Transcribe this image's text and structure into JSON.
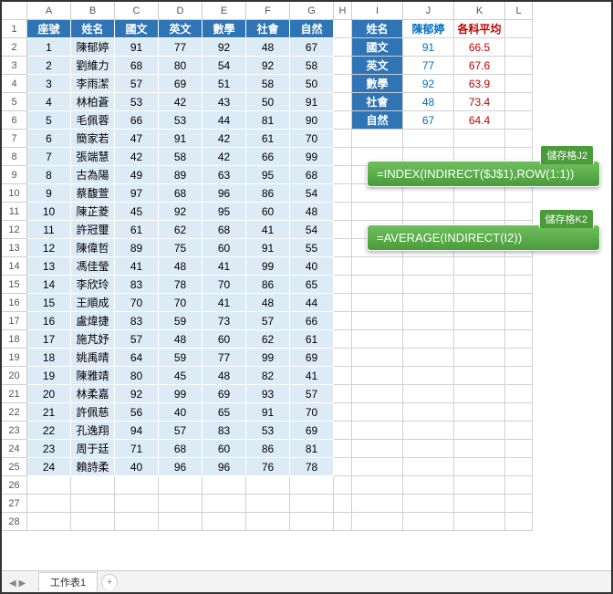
{
  "cols": [
    "",
    "A",
    "B",
    "C",
    "D",
    "E",
    "F",
    "G",
    "H",
    "I",
    "J",
    "K",
    "L"
  ],
  "rowcount": 28,
  "table": {
    "headers": [
      "座號",
      "姓名",
      "國文",
      "英文",
      "數學",
      "社會",
      "自然"
    ],
    "rows": [
      [
        "1",
        "陳郁婷",
        "91",
        "77",
        "92",
        "48",
        "67"
      ],
      [
        "2",
        "劉維力",
        "68",
        "80",
        "54",
        "92",
        "58"
      ],
      [
        "3",
        "李雨潔",
        "57",
        "69",
        "51",
        "58",
        "50"
      ],
      [
        "4",
        "林柏蒼",
        "53",
        "42",
        "43",
        "50",
        "91"
      ],
      [
        "5",
        "毛佩蓉",
        "66",
        "53",
        "44",
        "81",
        "90"
      ],
      [
        "6",
        "簡家若",
        "47",
        "91",
        "42",
        "61",
        "70"
      ],
      [
        "7",
        "張端慧",
        "42",
        "58",
        "42",
        "66",
        "99"
      ],
      [
        "8",
        "古為陽",
        "49",
        "89",
        "63",
        "95",
        "68"
      ],
      [
        "9",
        "蔡馥萱",
        "97",
        "68",
        "96",
        "86",
        "54"
      ],
      [
        "10",
        "陳芷菱",
        "45",
        "92",
        "95",
        "60",
        "48"
      ],
      [
        "11",
        "許冠璽",
        "61",
        "62",
        "68",
        "41",
        "54"
      ],
      [
        "12",
        "陳偉哲",
        "89",
        "75",
        "60",
        "91",
        "55"
      ],
      [
        "13",
        "馮佳瑩",
        "41",
        "48",
        "41",
        "99",
        "40"
      ],
      [
        "14",
        "李欣玲",
        "83",
        "78",
        "70",
        "86",
        "65"
      ],
      [
        "15",
        "王順成",
        "70",
        "70",
        "41",
        "48",
        "44"
      ],
      [
        "16",
        "盧煒捷",
        "83",
        "59",
        "73",
        "57",
        "66"
      ],
      [
        "17",
        "施芃妤",
        "57",
        "48",
        "60",
        "62",
        "61"
      ],
      [
        "18",
        "姚禹晴",
        "64",
        "59",
        "77",
        "99",
        "69"
      ],
      [
        "19",
        "陳雅靖",
        "80",
        "45",
        "48",
        "82",
        "41"
      ],
      [
        "20",
        "林柔嘉",
        "92",
        "99",
        "69",
        "93",
        "57"
      ],
      [
        "21",
        "許佩慈",
        "56",
        "40",
        "65",
        "91",
        "70"
      ],
      [
        "22",
        "孔逸翔",
        "94",
        "57",
        "83",
        "53",
        "69"
      ],
      [
        "23",
        "周于廷",
        "71",
        "68",
        "60",
        "86",
        "81"
      ],
      [
        "24",
        "賴詩柔",
        "40",
        "96",
        "96",
        "76",
        "78"
      ]
    ]
  },
  "summary": {
    "hdr": [
      "姓名",
      "陳郁婷",
      "各科平均"
    ],
    "rows": [
      [
        "國文",
        "91",
        "66.5"
      ],
      [
        "英文",
        "77",
        "67.6"
      ],
      [
        "數學",
        "92",
        "63.9"
      ],
      [
        "社會",
        "48",
        "73.4"
      ],
      [
        "自然",
        "67",
        "64.4"
      ]
    ]
  },
  "formula1": {
    "tag": "儲存格J2",
    "text": "=INDEX(INDIRECT($J$1),ROW(1:1))"
  },
  "formula2": {
    "tag": "儲存格K2",
    "text": "=AVERAGE(INDIRECT(I2))"
  },
  "sheet": {
    "tab1": "工作表1",
    "add": "+"
  }
}
